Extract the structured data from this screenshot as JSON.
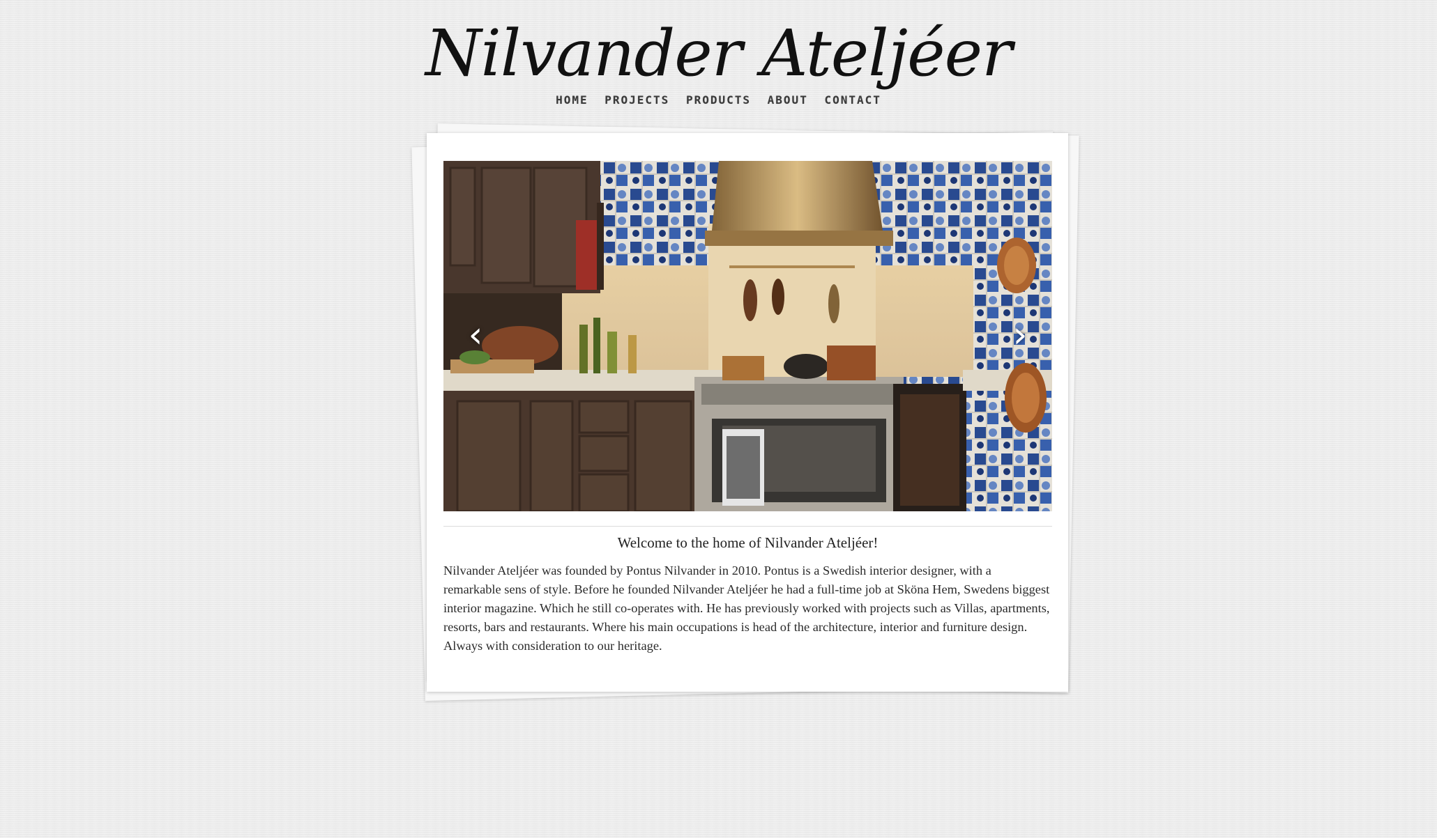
{
  "header": {
    "site_title": "Nilvander Ateljéer"
  },
  "nav": {
    "items": [
      {
        "label": "HOME"
      },
      {
        "label": "PROJECTS"
      },
      {
        "label": "PRODUCTS"
      },
      {
        "label": "ABOUT"
      },
      {
        "label": "CONTACT"
      }
    ]
  },
  "slider": {
    "prev_icon": "chevron-left-icon",
    "next_icon": "chevron-right-icon",
    "prev_glyph": "‹",
    "next_glyph": "›"
  },
  "content": {
    "welcome": "Welcome to the home of Nilvander Ateljéer!",
    "intro": "Nilvander Ateljéer was founded by Pontus Nilvander in 2010. Pontus is a Swedish interior designer, with a remarkable sens of style. Before he founded Nilvander Ateljéer he had a full-time job at Sköna Hem, Swedens biggest interior magazine. Which he still co-operates with. He has previously worked with projects such as Villas, apartments, resorts, bars and restaurants. Where his main occupations is head of the architecture, interior and furniture design. Always with consideration to our heritage."
  },
  "colors": {
    "background": "#ececec",
    "card": "#ffffff",
    "text": "#2b2b2b"
  }
}
